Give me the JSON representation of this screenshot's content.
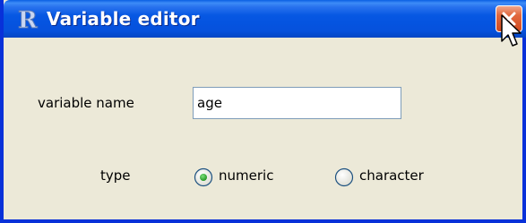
{
  "window": {
    "title": "Variable editor",
    "app_icon": "r-logo-icon",
    "close_icon": "close-icon"
  },
  "form": {
    "variable_name_label": "variable name",
    "variable_name_value": "age",
    "type_label": "type",
    "type_options": [
      {
        "label": "numeric",
        "selected": true
      },
      {
        "label": "character",
        "selected": false
      }
    ]
  },
  "colors": {
    "titlebar": "#0554e0",
    "window_border": "#0831d9",
    "dialog_background": "#ece9d8",
    "close_button": "#d24a20",
    "radio_selected_dot": "#21a121"
  }
}
